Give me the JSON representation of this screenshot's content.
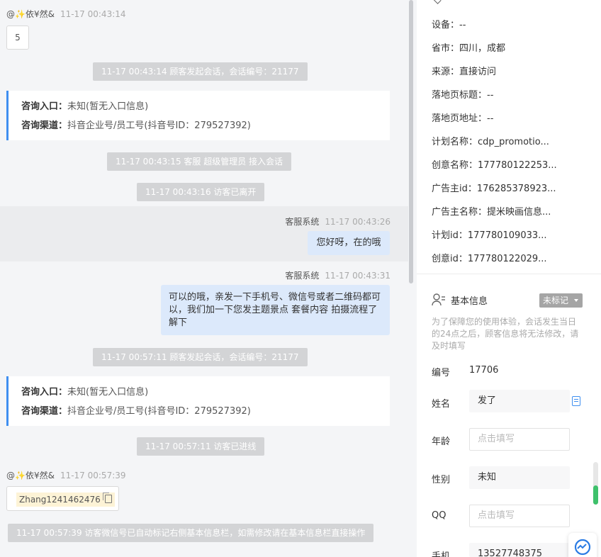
{
  "chat": {
    "visitor_name": "@✨依¥然&",
    "visitor_time_1": "11-17 00:43:14",
    "msg_number": "5",
    "sys_start_1": "11-17 00:43:14 顾客发起会话，会话编号：21177",
    "entry_label": "咨询入口：",
    "entry_value": "未知(暂无入口信息)",
    "channel_label": "咨询渠道：",
    "channel_value": "抖音企业号/员工号(抖音号ID：279527392)",
    "sys_join": "11-17 00:43:15 客服 超级管理员 接入会话",
    "sys_leave": "11-17 00:43:16 访客已离开",
    "agent_name": "客服系统",
    "agent_time_1": "11-17 00:43:26",
    "agent_msg_1": "您好呀，在的哦",
    "agent_time_2": "11-17 00:43:31",
    "agent_msg_2": "可以的哦，亲发一下手机号、微信号或者二维码都可以，我们加一下您发主题景点 套餐内容 拍摄流程了解下",
    "sys_start_2": "11-17 00:57:11 顾客发起会话，会话编号：21177",
    "sys_enter": "11-17 00:57:11 访客已进线",
    "visitor_time_2": "11-17 00:57:39",
    "wechat_id": "Zhang1241462476",
    "sys_auto": "11-17 00:57:39 访客微信号已自动标记右侧基本信息栏，如需修改请在基本信息栏直接操作"
  },
  "side": {
    "rows": [
      {
        "label": "设备：",
        "value": "--"
      },
      {
        "label": "省市：",
        "value": "四川，成都"
      },
      {
        "label": "来源：",
        "value": "直接访问"
      },
      {
        "label": "落地页标题：",
        "value": "--"
      },
      {
        "label": "落地页地址：",
        "value": "--"
      },
      {
        "label": "计划名称：",
        "value": "cdp_promotio..."
      },
      {
        "label": "创意名称：",
        "value": "177780122253..."
      },
      {
        "label": "广告主id：",
        "value": "176285378923..."
      },
      {
        "label": "广告主名称：",
        "value": "提米映画信息..."
      },
      {
        "label": "计划id：",
        "value": "177780109033..."
      },
      {
        "label": "创意id：",
        "value": "177780122029..."
      }
    ],
    "basic_title": "基本信息",
    "tag_label": "未标记",
    "note": "为了保障您的使用体验，会话发生当日的24点之后，顾客信息将无法修改，请及时填写",
    "id_label": "编号",
    "id_value": "17706",
    "name_label": "姓名",
    "name_value": "发了",
    "age_label": "年龄",
    "age_placeholder": "点击填写",
    "gender_label": "性别",
    "gender_value": "未知",
    "qq_label": "QQ",
    "qq_placeholder": "点击填写",
    "phone_label": "手机",
    "phone_value": "13527748375"
  },
  "colors": {
    "accent": "#3f8ff0",
    "bubble": "#dce9fb",
    "system_pill": "#d3d4d6",
    "tag_gray": "#a5a5a5",
    "scroll_green": "#3ec16b"
  }
}
